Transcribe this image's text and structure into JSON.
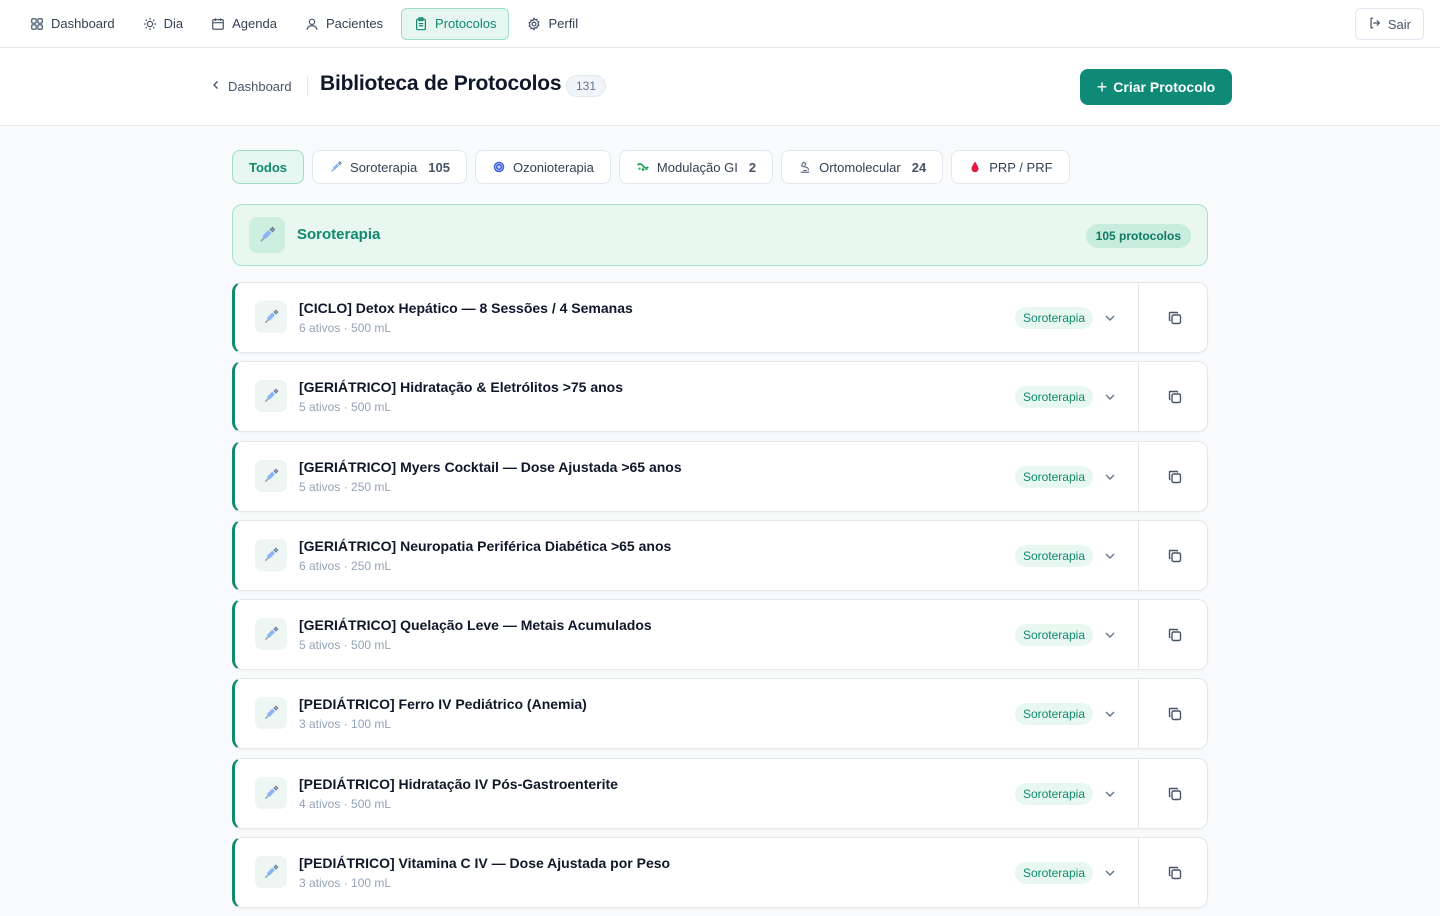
{
  "nav": {
    "items": [
      {
        "label": "Dashboard",
        "icon": "grid-icon"
      },
      {
        "label": "Dia",
        "icon": "sun-icon"
      },
      {
        "label": "Agenda",
        "icon": "calendar-icon"
      },
      {
        "label": "Pacientes",
        "icon": "user-icon"
      },
      {
        "label": "Protocolos",
        "icon": "clipboard-icon",
        "active": true
      },
      {
        "label": "Perfil",
        "icon": "gear-icon"
      }
    ],
    "logout_label": "Sair"
  },
  "header": {
    "back_label": "Dashboard",
    "title": "Biblioteca de Protocolos",
    "count": "131",
    "create_label": "Criar Protocolo"
  },
  "filters": [
    {
      "label": "Todos",
      "count": "",
      "icon": "",
      "active": true
    },
    {
      "label": "Soroterapia",
      "count": "105",
      "icon": "syringe-icon"
    },
    {
      "label": "Ozonioterapia",
      "count": "",
      "icon": "ozone-icon"
    },
    {
      "label": "Modulação GI",
      "count": "2",
      "icon": "gut-icon"
    },
    {
      "label": "Ortomolecular",
      "count": "24",
      "icon": "microscope-icon"
    },
    {
      "label": "PRP / PRF",
      "count": "",
      "icon": "drop-icon"
    }
  ],
  "category": {
    "title": "Soroterapia",
    "count_label": "105 protocolos"
  },
  "protocols": [
    {
      "title": "[CICLO] Detox Hepático — 8 Sessões / 4 Semanas",
      "meta": "6 ativos · 500 mL",
      "badge": "Soroterapia"
    },
    {
      "title": "[GERIÁTRICO] Hidratação & Eletrólitos >75 anos",
      "meta": "5 ativos · 500 mL",
      "badge": "Soroterapia"
    },
    {
      "title": "[GERIÁTRICO] Myers Cocktail — Dose Ajustada >65 anos",
      "meta": "5 ativos · 250 mL",
      "badge": "Soroterapia"
    },
    {
      "title": "[GERIÁTRICO] Neuropatia Periférica Diabética >65 anos",
      "meta": "6 ativos · 250 mL",
      "badge": "Soroterapia"
    },
    {
      "title": "[GERIÁTRICO] Quelação Leve — Metais Acumulados",
      "meta": "5 ativos · 500 mL",
      "badge": "Soroterapia"
    },
    {
      "title": "[PEDIÁTRICO] Ferro IV Pediátrico (Anemia)",
      "meta": "3 ativos · 100 mL",
      "badge": "Soroterapia"
    },
    {
      "title": "[PEDIÁTRICO] Hidratação IV Pós-Gastroenterite",
      "meta": "4 ativos · 500 mL",
      "badge": "Soroterapia"
    },
    {
      "title": "[PEDIÁTRICO] Vitamina C IV — Dose Ajustada por Peso",
      "meta": "3 ativos · 100 mL",
      "badge": "Soroterapia"
    }
  ],
  "colors": {
    "accent": "#0f8a6d",
    "accent_button": "#0f8a77",
    "accent_light": "#e8f8f1"
  }
}
